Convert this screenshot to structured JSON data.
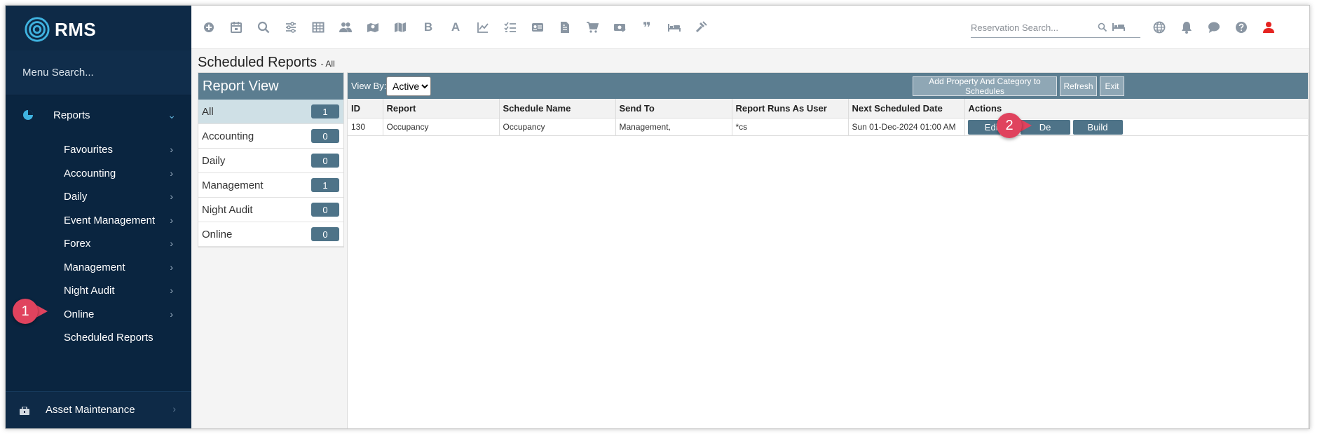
{
  "app": {
    "logo_text": "RMS",
    "menu_search_placeholder": "Menu Search..."
  },
  "sidebar": {
    "reports_label": "Reports",
    "items": [
      {
        "label": "Favourites"
      },
      {
        "label": "Accounting"
      },
      {
        "label": "Daily"
      },
      {
        "label": "Event Management"
      },
      {
        "label": "Forex"
      },
      {
        "label": "Management"
      },
      {
        "label": "Night Audit"
      },
      {
        "label": "Online"
      }
    ],
    "scheduled_reports_label": "Scheduled Reports",
    "asset_maintenance_label": "Asset Maintenance"
  },
  "toolbar": {
    "icons": [
      "plus-circle-icon",
      "calendar-icon",
      "search-icon",
      "sliders-icon",
      "grid-icon",
      "users-icon",
      "map-pin-icon",
      "map-icon",
      "bold-b-icon",
      "font-a-icon",
      "line-chart-icon",
      "checklist-icon",
      "id-card-icon",
      "document-icon",
      "cart-icon",
      "money-icon",
      "quote-icon",
      "bed-icon",
      "hammer-icon"
    ],
    "glyph_b": "B",
    "glyph_a": "A",
    "glyph_quote": "❞",
    "reservation_search_placeholder": "Reservation Search...",
    "right_icons": [
      "globe-icon",
      "bell-icon",
      "chat-icon",
      "help-icon",
      "user-icon"
    ]
  },
  "page": {
    "title": "Scheduled Reports",
    "subtitle": "- All"
  },
  "report_view": {
    "header": "Report View",
    "rows": [
      {
        "label": "All",
        "count": "1"
      },
      {
        "label": "Accounting",
        "count": "0"
      },
      {
        "label": "Daily",
        "count": "0"
      },
      {
        "label": "Management",
        "count": "1"
      },
      {
        "label": "Night Audit",
        "count": "0"
      },
      {
        "label": "Online",
        "count": "0"
      }
    ]
  },
  "schedules": {
    "view_by_label": "View By:",
    "view_by_value": "Active",
    "buttons": {
      "add_property": "Add Property And Category to Schedules",
      "refresh": "Refresh",
      "exit": "Exit"
    },
    "columns": [
      "ID",
      "Report",
      "Schedule Name",
      "Send To",
      "Report Runs As User",
      "Next Scheduled Date",
      "Actions"
    ],
    "rows": [
      {
        "id": "130",
        "report": "Occupancy",
        "schedule_name": "Occupancy",
        "send_to": "Management,",
        "runs_as": "*cs",
        "next_date": "Sun 01-Dec-2024 01:00 AM",
        "actions": {
          "edit": "Edit",
          "delete": "De",
          "build": "Build"
        }
      }
    ]
  },
  "callouts": {
    "one": "1",
    "two": "2"
  },
  "colors": {
    "sidebar": "#0e2a47",
    "panel_header": "#5b7d90",
    "badge": "#4e7388",
    "callout": "#e0435e",
    "accent_chevron": "#5fb0d8"
  }
}
